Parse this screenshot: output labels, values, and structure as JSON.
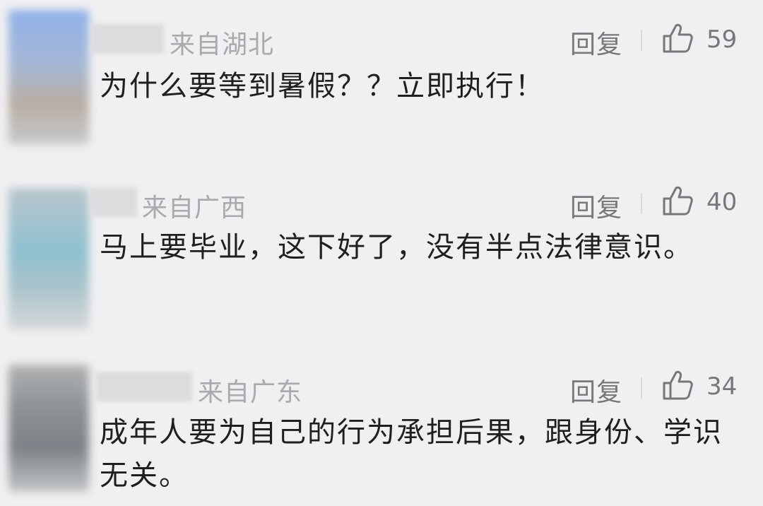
{
  "comments": [
    {
      "location": "来自湖北",
      "reply_label": "回复",
      "like_icon": "thumbs-up-icon",
      "likes": "59",
      "text": "为什么要等到暑假？？立即执行！"
    },
    {
      "location": "来自广西",
      "reply_label": "回复",
      "like_icon": "thumbs-up-icon",
      "likes": "40",
      "text": "马上要毕业，这下好了，没有半点法律意识。"
    },
    {
      "location": "来自广东",
      "reply_label": "回复",
      "like_icon": "thumbs-up-icon",
      "likes": "34",
      "text": "成年人要为自己的行为承担后果，跟身份、学识无关。"
    }
  ],
  "colors": {
    "background": "#f0f0f2",
    "text": "#1f1f22",
    "meta": "#a9a9ae",
    "action": "#77777c"
  }
}
